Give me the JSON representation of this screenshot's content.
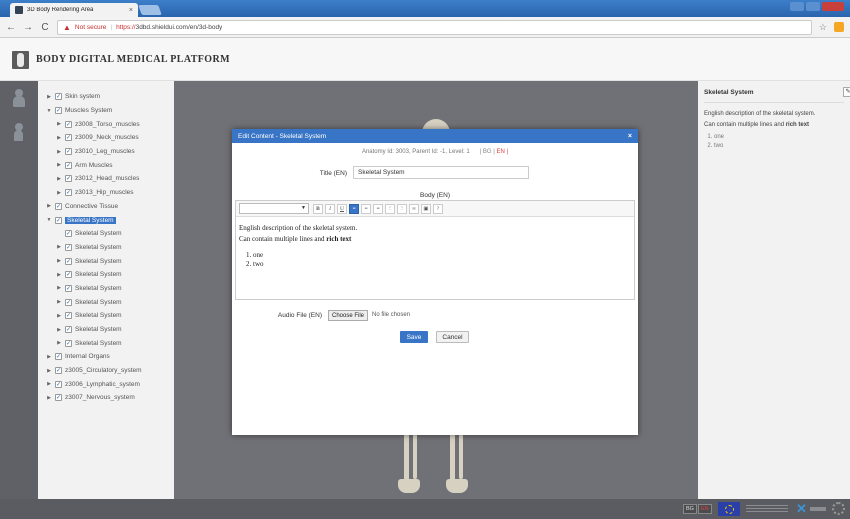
{
  "browser": {
    "tab_title": "3D Body Rendering Area",
    "tab_close": "×",
    "not_secure": "Not secure",
    "url_scheme": "https://",
    "url_rest": "3dbd.shieldui.com/en/3d-body",
    "back_glyph": "←",
    "forward_glyph": "→",
    "reload_glyph": "C",
    "star_glyph": "☆"
  },
  "app": {
    "title": "BODY DIGITAL MEDICAL PLATFORM"
  },
  "tree": [
    {
      "label": "Skin system",
      "indent": 0,
      "caret": "▶",
      "checked": true
    },
    {
      "label": "Muscles System",
      "indent": 0,
      "caret": "▼",
      "checked": true
    },
    {
      "label": "z3008_Torso_muscles",
      "indent": 1,
      "caret": "▶",
      "checked": true
    },
    {
      "label": "z3009_Neck_muscles",
      "indent": 1,
      "caret": "▶",
      "checked": true
    },
    {
      "label": "z3010_Leg_muscles",
      "indent": 1,
      "caret": "▶",
      "checked": true
    },
    {
      "label": "Arm Muscles",
      "indent": 1,
      "caret": "▶",
      "checked": true
    },
    {
      "label": "z3012_Head_muscles",
      "indent": 1,
      "caret": "▶",
      "checked": true
    },
    {
      "label": "z3013_Hip_muscles",
      "indent": 1,
      "caret": "▶",
      "checked": true
    },
    {
      "label": "Connective Tissue",
      "indent": 0,
      "caret": "▶",
      "checked": true
    },
    {
      "label": "Skeletal System",
      "indent": 0,
      "caret": "▼",
      "checked": true,
      "selected": true
    },
    {
      "label": "Skeletal System",
      "indent": 1,
      "caret": "",
      "checked": true
    },
    {
      "label": "Skeletal System",
      "indent": 1,
      "caret": "▶",
      "checked": true
    },
    {
      "label": "Skeletal System",
      "indent": 1,
      "caret": "▶",
      "checked": true
    },
    {
      "label": "Skeletal System",
      "indent": 1,
      "caret": "▶",
      "checked": true
    },
    {
      "label": "Skeletal System",
      "indent": 1,
      "caret": "▶",
      "checked": true
    },
    {
      "label": "Skeletal System",
      "indent": 1,
      "caret": "▶",
      "checked": true
    },
    {
      "label": "Skeletal System",
      "indent": 1,
      "caret": "▶",
      "checked": true
    },
    {
      "label": "Skeletal System",
      "indent": 1,
      "caret": "▶",
      "checked": true
    },
    {
      "label": "Skeletal System",
      "indent": 1,
      "caret": "▶",
      "checked": true
    },
    {
      "label": "Internal Organs",
      "indent": 0,
      "caret": "▶",
      "checked": true
    },
    {
      "label": "z3005_Circulatory_system",
      "indent": 0,
      "caret": "▶",
      "checked": true
    },
    {
      "label": "z3006_Lymphatic_system",
      "indent": 0,
      "caret": "▶",
      "checked": true
    },
    {
      "label": "z3007_Nervous_system",
      "indent": 0,
      "caret": "▶",
      "checked": true
    }
  ],
  "right_panel": {
    "title": "Skeletal System",
    "desc_line1": "English description of the skeletal system.",
    "desc_line2_plain": "Can contain multiple lines and ",
    "desc_line2_bold": "rich text",
    "list": [
      "one",
      "two"
    ]
  },
  "modal": {
    "title": "Edit Content - Skeletal System",
    "close_glyph": "×",
    "meta": "Anatomy Id: 3003, Parent Id: -1, Level: 1",
    "lang_bg": "| BG |",
    "lang_en": "EN",
    "lang_end": "|",
    "title_label": "Title (EN)",
    "title_value": "Skeletal System",
    "body_label": "Body (EN)",
    "body_line1": "English description of the skeletal system.",
    "body_line2_plain": "Can contain multiple lines and ",
    "body_line2_bold": "rich text",
    "body_list": [
      "one",
      "two"
    ],
    "audio_label": "Audio File (EN)",
    "choose_file": "Choose File",
    "no_file": "No file chosen",
    "save": "Save",
    "cancel": "Cancel"
  },
  "editor_toolbar": [
    {
      "name": "bold-button",
      "glyph": "B"
    },
    {
      "name": "italic-button",
      "glyph": "I"
    },
    {
      "name": "underline-button",
      "glyph": "U"
    },
    {
      "name": "align-left-button",
      "glyph": "≡",
      "active": true
    },
    {
      "name": "align-center-button",
      "glyph": "≡"
    },
    {
      "name": "align-right-button",
      "glyph": "≡"
    },
    {
      "name": "ordered-list-button",
      "glyph": "⋮"
    },
    {
      "name": "unordered-list-button",
      "glyph": "⋮"
    },
    {
      "name": "link-button",
      "glyph": "∞"
    },
    {
      "name": "image-button",
      "glyph": "▣"
    },
    {
      "name": "help-button",
      "glyph": "?"
    }
  ],
  "footer": {
    "lang_bg": "BG",
    "lang_en": "EN"
  },
  "colors": {
    "accent": "#3875c6",
    "active_lang": "#e04040"
  }
}
